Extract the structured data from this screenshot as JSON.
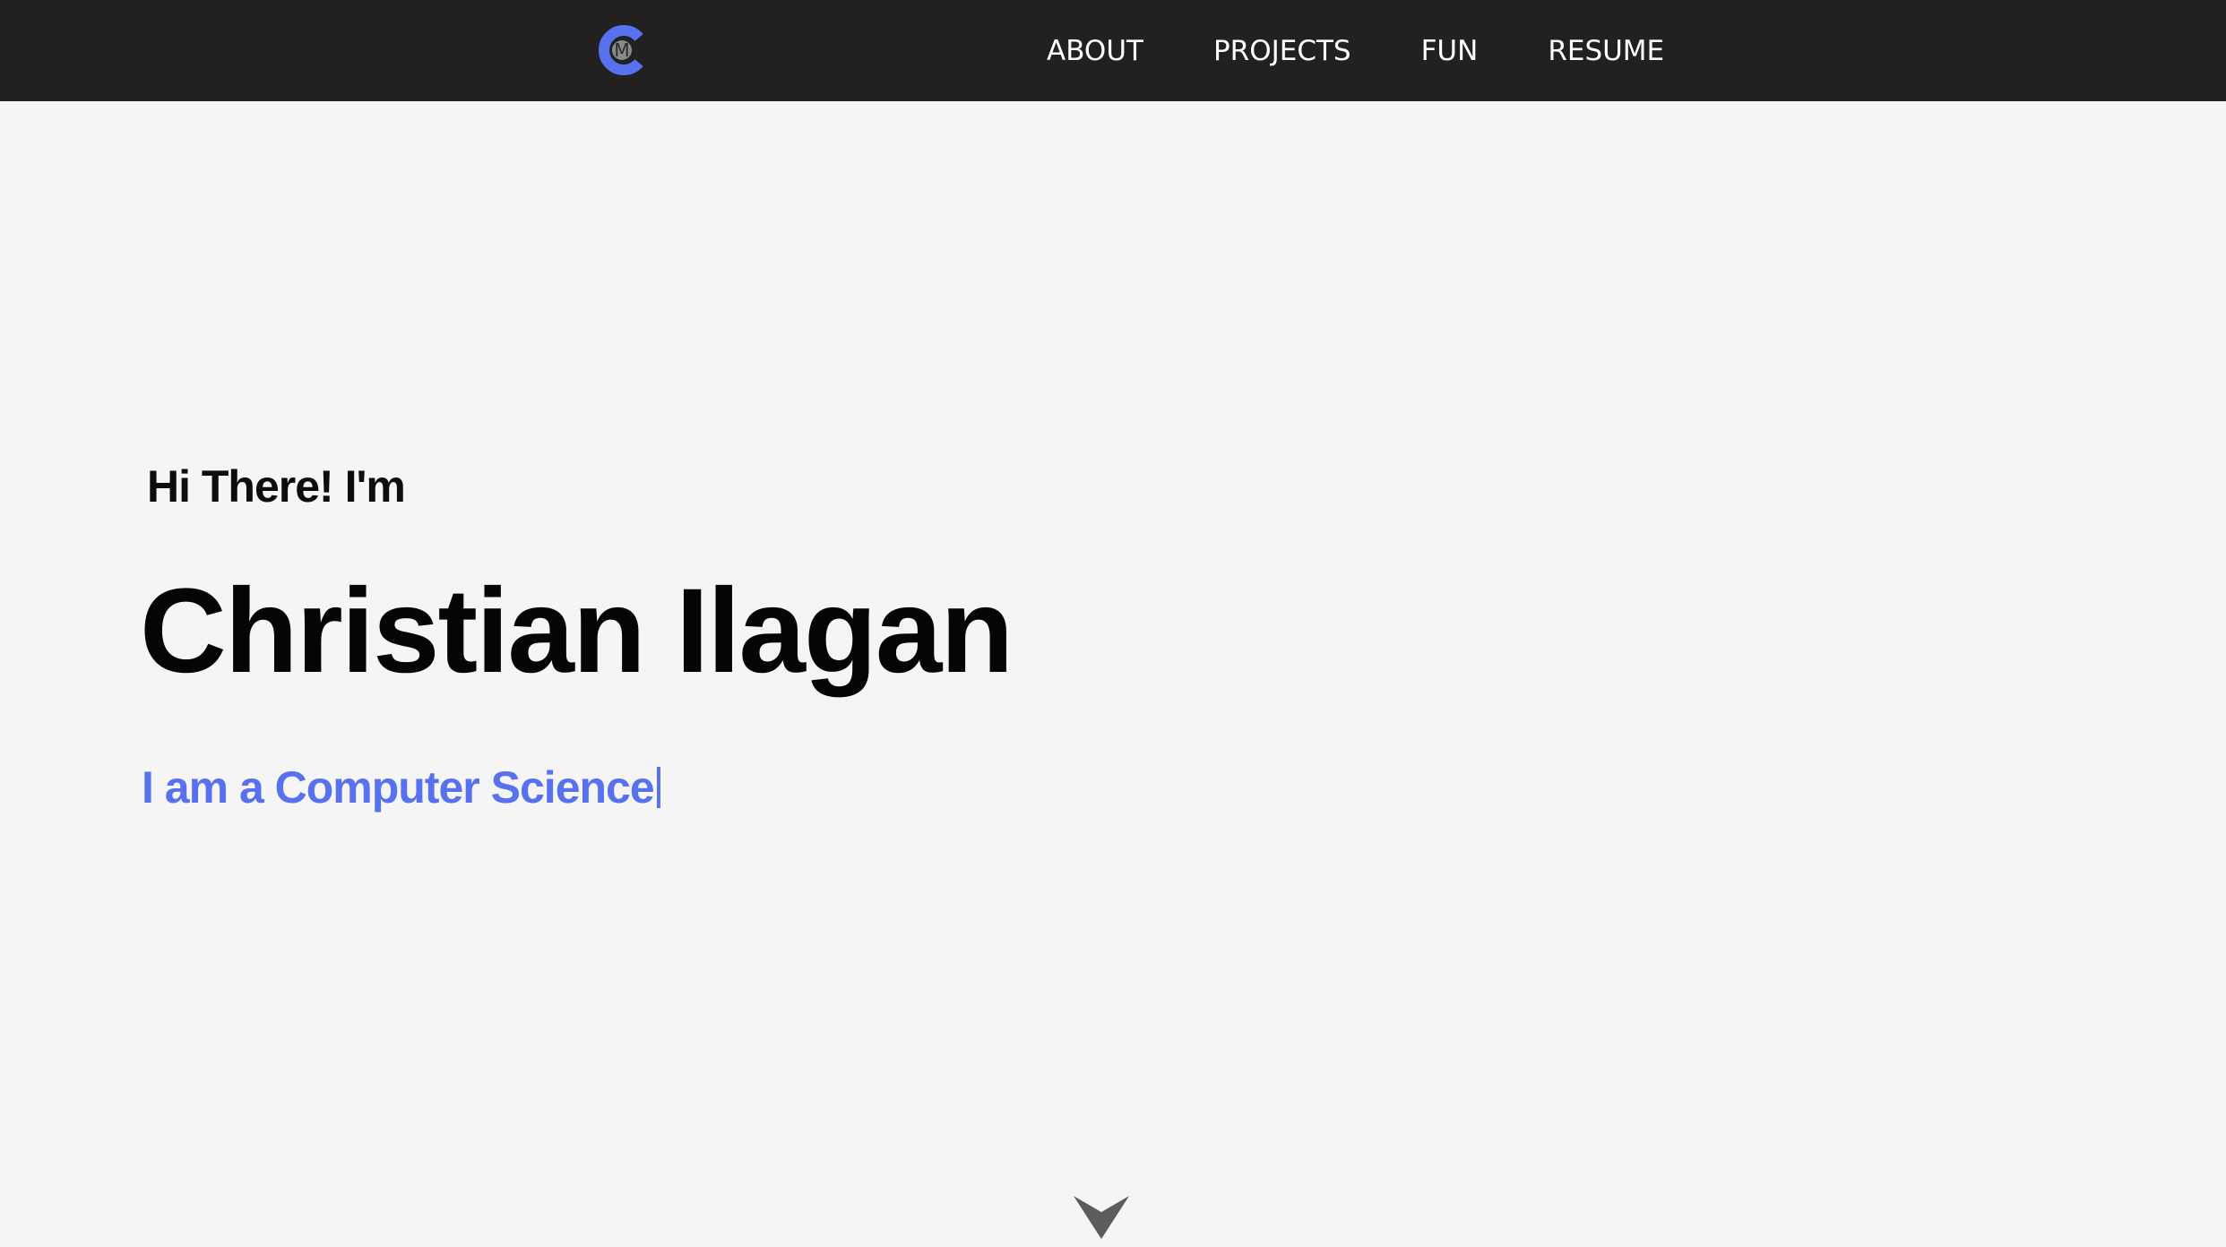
{
  "navbar": {
    "logo_letters": "CM",
    "links": [
      {
        "label": "ABOUT"
      },
      {
        "label": "PROJECTS"
      },
      {
        "label": "FUN"
      },
      {
        "label": "RESUME"
      }
    ]
  },
  "hero": {
    "greeting": "Hi There! I'm",
    "name": "Christian Ilagan",
    "typed_text": "I am a Computer Science"
  },
  "colors": {
    "navbar_bg": "#212121",
    "page_bg": "#f5f5f5",
    "accent": "#5871ee",
    "scroll_arrow": "#5c5c5c"
  },
  "icons": {
    "logo": "cm-monogram-icon",
    "scroll": "chevron-down-icon"
  }
}
